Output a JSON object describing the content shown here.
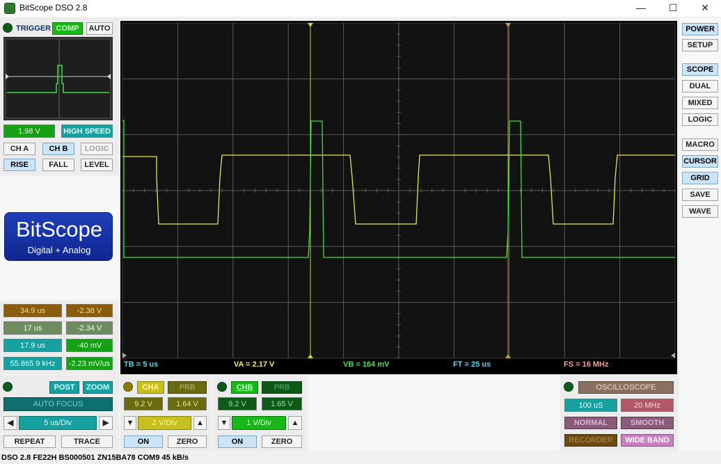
{
  "window": {
    "title": "BitScope DSO 2.8",
    "minimize": "—",
    "maximize": "☐",
    "close": "✕"
  },
  "trigger": {
    "label": "TRIGGER",
    "comp": "COMP",
    "auto": "AUTO",
    "level_value": "1.98 V",
    "high_speed": "HIGH SPEED",
    "cha": "CH A",
    "chb": "CH B",
    "logic": "LOGIC",
    "rise": "RISE",
    "fall": "FALL",
    "level": "LEVEL"
  },
  "logo": {
    "brand": "BitScope",
    "tagline": "Digital + Analog"
  },
  "measurements": [
    {
      "left": "34.9 us",
      "right": "-2.38 V"
    },
    {
      "left": "17 us",
      "right": "-2.34 V"
    },
    {
      "left": "17.9 us",
      "right": "-40 mV"
    },
    {
      "left": "55.865 9 kHz",
      "right": "-2.23 mV/us"
    }
  ],
  "timebase": {
    "post": "POST",
    "zoom": "ZOOM",
    "auto_focus": "AUTO FOCUS",
    "value": "5 us/Div",
    "prev": "◀",
    "next": "▶",
    "repeat": "REPEAT",
    "trace": "TRACE"
  },
  "channel_a": {
    "name": "CHA",
    "probe": "PRB",
    "range": "9.2 V",
    "offset": "1.64 V",
    "scale": "2 V/Div",
    "down": "▼",
    "up": "▲",
    "on": "ON",
    "zero": "ZERO"
  },
  "channel_b": {
    "name": "CHB",
    "probe": "PRB",
    "range": "9.2 V",
    "offset": "1.65 V",
    "scale": "1 V/Div",
    "down": "▼",
    "up": "▲",
    "on": "ON",
    "zero": "ZERO"
  },
  "scope_readout": {
    "tb": "TB = 5 us",
    "va": "VA = 2.17 V",
    "vb": "VB = 164 mV",
    "ft": "FT = 25 us",
    "fs": "FS = 16 MHz"
  },
  "mode_panel": {
    "oscilloscope": "OSCILLOSCOPE",
    "sample": "100 uS",
    "bandwidth": "20 MHz",
    "normal": "NORMAL",
    "smooth": "SMOOTH",
    "recorder": "RECORDER",
    "wide_band": "WIDE BAND"
  },
  "side_menu": {
    "power": "POWER",
    "setup": "SETUP",
    "scope": "SCOPE",
    "dual": "DUAL",
    "mixed": "MIXED",
    "logic": "LOGIC",
    "macro": "MACRO",
    "cursor": "CURSOR",
    "grid": "GRID",
    "save": "SAVE",
    "wave": "WAVE"
  },
  "status_bar": "DSO 2.8 FE22H BS000501 ZN15BA78 COM9 45 kB/s",
  "colors": {
    "trace_a": "#e8e84a",
    "trace_b": "#3de03d",
    "cursor_b": "#b8e040",
    "cursor_a": "#c8a030",
    "grid": "#5a5a5a",
    "scope_bg": "#000000"
  }
}
